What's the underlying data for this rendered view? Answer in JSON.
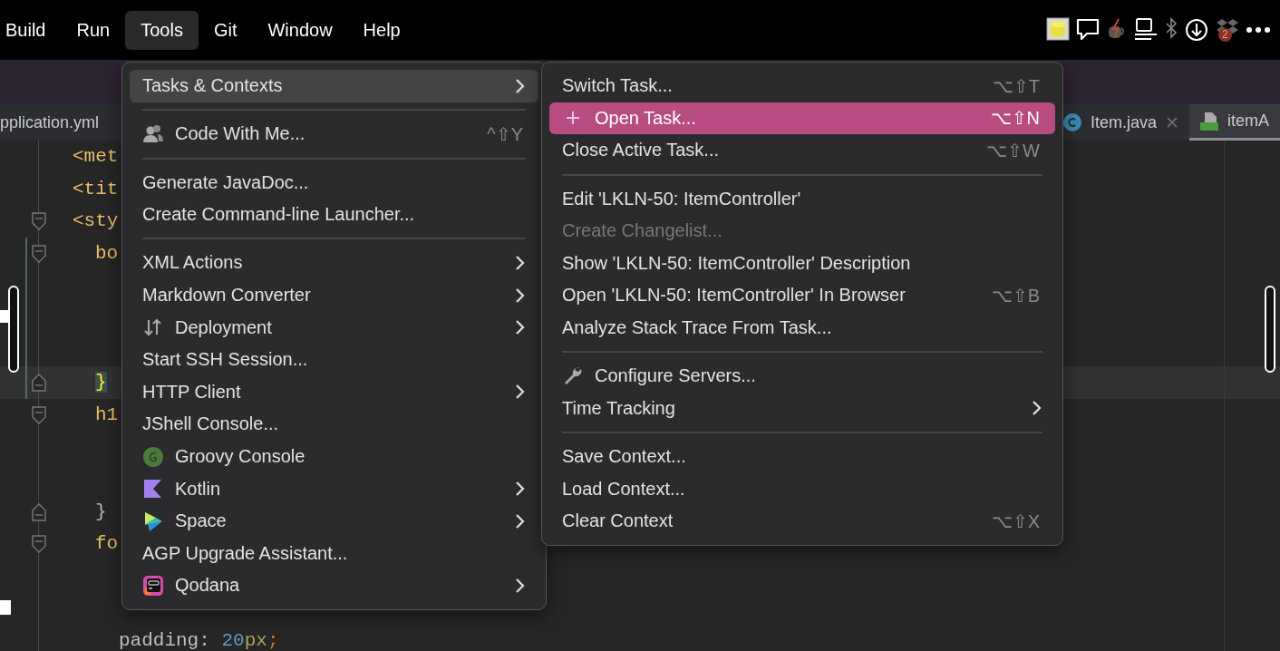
{
  "menu_bar": {
    "items": [
      {
        "label": "Build",
        "selected": false
      },
      {
        "label": "Run",
        "selected": false
      },
      {
        "label": "Tools",
        "selected": true
      },
      {
        "label": "Git",
        "selected": false
      },
      {
        "label": "Window",
        "selected": false
      },
      {
        "label": "Help",
        "selected": false
      }
    ],
    "status_icons": [
      {
        "kind": "database"
      },
      {
        "kind": "chat"
      },
      {
        "kind": "cup"
      },
      {
        "kind": "monitor"
      },
      {
        "kind": "bluetooth"
      },
      {
        "kind": "download"
      },
      {
        "kind": "boxes",
        "badge": "2"
      },
      {
        "kind": "more"
      }
    ]
  },
  "tabs": [
    {
      "label": "pplication.yml",
      "kind": "plain",
      "closable": false,
      "selected": false
    },
    {
      "label": "Item.java",
      "kind": "class",
      "closable": true,
      "selected": false
    },
    {
      "label": "itemA",
      "kind": "html",
      "closable": false,
      "selected": true
    }
  ],
  "editor": {
    "lines": [
      {
        "kind": "markup",
        "fold_open": false,
        "fold_close": false,
        "changed": false,
        "current": false,
        "tokens": [
          {
            "text": "<met",
            "kind": "tag"
          }
        ]
      },
      {
        "kind": "markup",
        "fold_open": false,
        "fold_close": false,
        "changed": false,
        "current": false,
        "tokens": [
          {
            "text": "<tit",
            "kind": "tag"
          }
        ]
      },
      {
        "kind": "markup",
        "fold_open": true,
        "fold_close": false,
        "changed": false,
        "current": false,
        "tokens": [
          {
            "text": "<sty",
            "kind": "tag"
          }
        ]
      },
      {
        "kind": "rule",
        "fold_open": true,
        "fold_close": false,
        "changed": true,
        "current": false,
        "tokens": [
          {
            "text": "bo",
            "kind": "tag"
          }
        ]
      },
      {
        "kind": "blank",
        "fold_open": false,
        "fold_close": false,
        "changed": true,
        "current": false
      },
      {
        "kind": "blank",
        "fold_open": false,
        "fold_close": false,
        "changed": true,
        "current": false
      },
      {
        "kind": "blank",
        "fold_open": false,
        "fold_close": false,
        "changed": true,
        "current": false
      },
      {
        "kind": "rule",
        "fold_open": false,
        "fold_close": true,
        "changed": true,
        "current": true,
        "tokens": [
          {
            "text": "}",
            "kind": "brace-match"
          }
        ]
      },
      {
        "kind": "rule",
        "fold_open": true,
        "fold_close": false,
        "changed": false,
        "current": false,
        "tokens": [
          {
            "text": "h1",
            "kind": "tag"
          }
        ]
      },
      {
        "kind": "blank",
        "fold_open": false,
        "fold_close": false,
        "changed": false,
        "current": false
      },
      {
        "kind": "blank",
        "fold_open": false,
        "fold_close": false,
        "changed": false,
        "current": false
      },
      {
        "kind": "rule",
        "fold_open": false,
        "fold_close": true,
        "changed": false,
        "current": false,
        "tokens": [
          {
            "text": "}",
            "kind": "brace"
          }
        ]
      },
      {
        "kind": "rule",
        "fold_open": true,
        "fold_close": false,
        "changed": false,
        "current": false,
        "tokens": [
          {
            "text": "fo",
            "kind": "tag"
          }
        ]
      },
      {
        "kind": "blank",
        "fold_open": false,
        "fold_close": false,
        "changed": false,
        "current": false
      },
      {
        "kind": "blank",
        "fold_open": false,
        "fold_close": false,
        "changed": false,
        "current": false
      },
      {
        "kind": "declaration",
        "fold_open": false,
        "fold_close": false,
        "changed": false,
        "current": false,
        "tokens": [
          {
            "text": "padding",
            "kind": "property"
          },
          {
            "text": ": ",
            "kind": "property"
          },
          {
            "text": "20",
            "kind": "number"
          },
          {
            "text": "px",
            "kind": "unit"
          },
          {
            "text": ";",
            "kind": "punct"
          }
        ]
      }
    ]
  },
  "tools_menu": {
    "items": [
      {
        "kind": "plain",
        "label": "Tasks & Contexts",
        "submenu": true,
        "selected": true,
        "disabled": false
      },
      {
        "kind": "separator"
      },
      {
        "kind": "people",
        "label": "Code With Me...",
        "shortcut": "^⇧Y",
        "submenu": false,
        "selected": false,
        "disabled": false
      },
      {
        "kind": "separator"
      },
      {
        "kind": "plain",
        "label": "Generate JavaDoc...",
        "submenu": false,
        "selected": false,
        "disabled": false
      },
      {
        "kind": "plain",
        "label": "Create Command-line Launcher...",
        "submenu": false,
        "selected": false,
        "disabled": false
      },
      {
        "kind": "separator"
      },
      {
        "kind": "plain",
        "label": "XML Actions",
        "submenu": true,
        "selected": false,
        "disabled": false
      },
      {
        "kind": "plain",
        "label": "Markdown Converter",
        "submenu": true,
        "selected": false,
        "disabled": false
      },
      {
        "kind": "arrows",
        "label": "Deployment",
        "submenu": true,
        "selected": false,
        "disabled": false
      },
      {
        "kind": "plain",
        "label": "Start SSH Session...",
        "submenu": false,
        "selected": false,
        "disabled": false
      },
      {
        "kind": "plain",
        "label": "HTTP Client",
        "submenu": true,
        "selected": false,
        "disabled": false
      },
      {
        "kind": "plain",
        "label": "JShell Console...",
        "submenu": false,
        "selected": false,
        "disabled": false
      },
      {
        "kind": "groovy",
        "label": "Groovy Console",
        "submenu": false,
        "selected": false,
        "disabled": false
      },
      {
        "kind": "kotlin",
        "label": "Kotlin",
        "submenu": true,
        "selected": false,
        "disabled": false
      },
      {
        "kind": "space",
        "label": "Space",
        "submenu": true,
        "selected": false,
        "disabled": false
      },
      {
        "kind": "plain",
        "label": "AGP Upgrade Assistant...",
        "submenu": false,
        "selected": false,
        "disabled": false
      },
      {
        "kind": "qodana",
        "label": "Qodana",
        "submenu": true,
        "selected": false,
        "disabled": false
      }
    ]
  },
  "tasks_submenu": {
    "items": [
      {
        "kind": "plain",
        "label": "Switch Task...",
        "shortcut": "⌥⇧T",
        "submenu": false,
        "selected": false,
        "disabled": false
      },
      {
        "kind": "plus",
        "label": "Open Task...",
        "shortcut": "⌥⇧N",
        "submenu": false,
        "selected": true,
        "disabled": false
      },
      {
        "kind": "plain",
        "label": "Close Active Task...",
        "shortcut": "⌥⇧W",
        "submenu": false,
        "selected": false,
        "disabled": false
      },
      {
        "kind": "separator"
      },
      {
        "kind": "plain",
        "label": "Edit 'LKLN-50: ItemController'",
        "submenu": false,
        "selected": false,
        "disabled": false
      },
      {
        "kind": "plain",
        "label": "Create Changelist...",
        "submenu": false,
        "selected": false,
        "disabled": true
      },
      {
        "kind": "plain",
        "label": "Show 'LKLN-50: ItemController' Description",
        "submenu": false,
        "selected": false,
        "disabled": false
      },
      {
        "kind": "plain",
        "label": "Open 'LKLN-50: ItemController' In Browser",
        "shortcut": "⌥⇧B",
        "submenu": false,
        "selected": false,
        "disabled": false
      },
      {
        "kind": "plain",
        "label": "Analyze Stack Trace From Task...",
        "submenu": false,
        "selected": false,
        "disabled": false
      },
      {
        "kind": "separator"
      },
      {
        "kind": "wrench",
        "label": "Configure Servers...",
        "submenu": false,
        "selected": false,
        "disabled": false
      },
      {
        "kind": "plain",
        "label": "Time Tracking",
        "submenu": true,
        "selected": false,
        "disabled": false
      },
      {
        "kind": "separator"
      },
      {
        "kind": "plain",
        "label": "Save Context...",
        "submenu": false,
        "selected": false,
        "disabled": false
      },
      {
        "kind": "plain",
        "label": "Load Context...",
        "submenu": false,
        "selected": false,
        "disabled": false
      },
      {
        "kind": "plain",
        "label": "Clear Context",
        "shortcut": "⌥⇧X",
        "submenu": false,
        "selected": false,
        "disabled": false
      }
    ]
  }
}
